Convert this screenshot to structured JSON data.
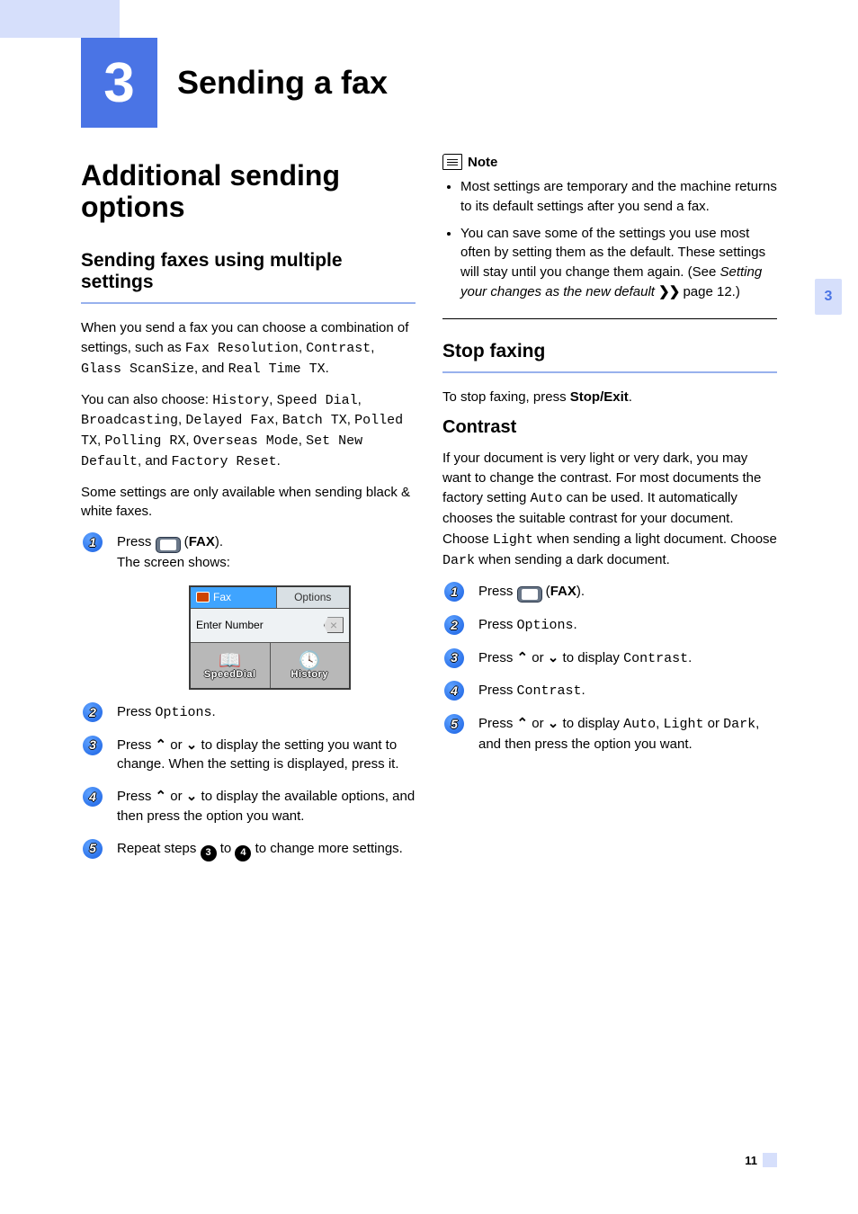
{
  "chapter": {
    "number": "3",
    "title": "Sending a fax",
    "sidetab": "3",
    "page_number": "11"
  },
  "left": {
    "h1": "Additional sending options",
    "h2": "Sending faxes using multiple settings",
    "p1_pre": "When you send a fax you can choose a combination of settings, such as ",
    "p1_codes": [
      "Fax Resolution",
      "Contrast",
      "Glass ScanSize",
      "Real Time TX"
    ],
    "p2_pre": "You can also choose: ",
    "p2_codes": [
      "History",
      "Speed Dial",
      "Broadcasting",
      "Delayed Fax",
      "Batch TX",
      "Polled TX",
      "Polling RX",
      "Overseas Mode",
      "Set New Default",
      "Factory Reset"
    ],
    "p3": "Some settings are only available when sending black & white faxes.",
    "steps": [
      {
        "n": "1",
        "txt": "Press ",
        "fax": "FAX",
        "tail": ").",
        "sub": "The screen shows:"
      },
      {
        "n": "2",
        "txt": "Press ",
        "code": "Options",
        "tail": "."
      },
      {
        "n": "3",
        "txt_a": "Press ",
        "arrow_up": "⌃",
        "txt_b": " or ",
        "arrow_down": "⌄",
        "txt_c": " to display the setting you want to change. When the setting is displayed, press it."
      },
      {
        "n": "4",
        "txt_a": "Press ",
        "arrow_up": "⌃",
        "txt_b": " or ",
        "arrow_down": "⌄",
        "txt_c": " to display the available options, and then press the option you want."
      },
      {
        "n": "5",
        "txt_a": "Repeat steps ",
        "ref1": "3",
        "txt_b": " to ",
        "ref2": "4",
        "txt_c": " to change more settings."
      }
    ],
    "screen": {
      "tab_left": "Fax",
      "tab_right": "Options",
      "entry": "Enter Number",
      "btn_left": "SpeedDial",
      "btn_right": "History"
    }
  },
  "right": {
    "note_label": "Note",
    "note_items": [
      {
        "t": "Most settings are temporary and the machine returns to its default settings after you send a fax."
      },
      {
        "t": "You can save some of the settings you use most often by setting them as the default. These settings will stay until you change them again. (See ",
        "ref": "Setting your changes as the new default",
        "tail": " page 12.)"
      }
    ],
    "h2a": "Stop faxing",
    "p_stop_a": "To stop faxing, press ",
    "p_stop_b": "Stop/Exit",
    "h2b": "Contrast",
    "p_contrast_a": "If your document is very light or very dark, you may want to change the contrast. For most documents the factory setting ",
    "p_contrast_code1": "Auto",
    "p_contrast_b": " can be used. It automatically chooses the suitable contrast for your document.",
    "p_contrast_c": "Choose ",
    "p_contrast_code2": "Light",
    "p_contrast_d": " when sending a light document. Choose ",
    "p_contrast_code3": "Dark",
    "p_contrast_e": " when sending a dark document.",
    "steps": [
      {
        "n": "1",
        "txt": "Press ",
        "fax": "FAX",
        "tail": ")."
      },
      {
        "n": "2",
        "txt": "Press ",
        "code": "Options",
        "tail": "."
      },
      {
        "n": "3",
        "txt_a": "Press ",
        "arrow_up": "⌃",
        "txt_b": " or ",
        "arrow_down": "⌄",
        "txt_c": " to display ",
        "code": "Contrast",
        "tail": "."
      },
      {
        "n": "4",
        "txt": "Press ",
        "code": "Contrast",
        "tail": "."
      },
      {
        "n": "5",
        "txt_a": "Press ",
        "arrow_up": "⌃",
        "txt_b": " or ",
        "arrow_down": "⌄",
        "txt_c": " to display ",
        "codes": [
          "Auto",
          "Light",
          "Dark"
        ],
        "tail": ", and then press the option you want."
      }
    ]
  }
}
